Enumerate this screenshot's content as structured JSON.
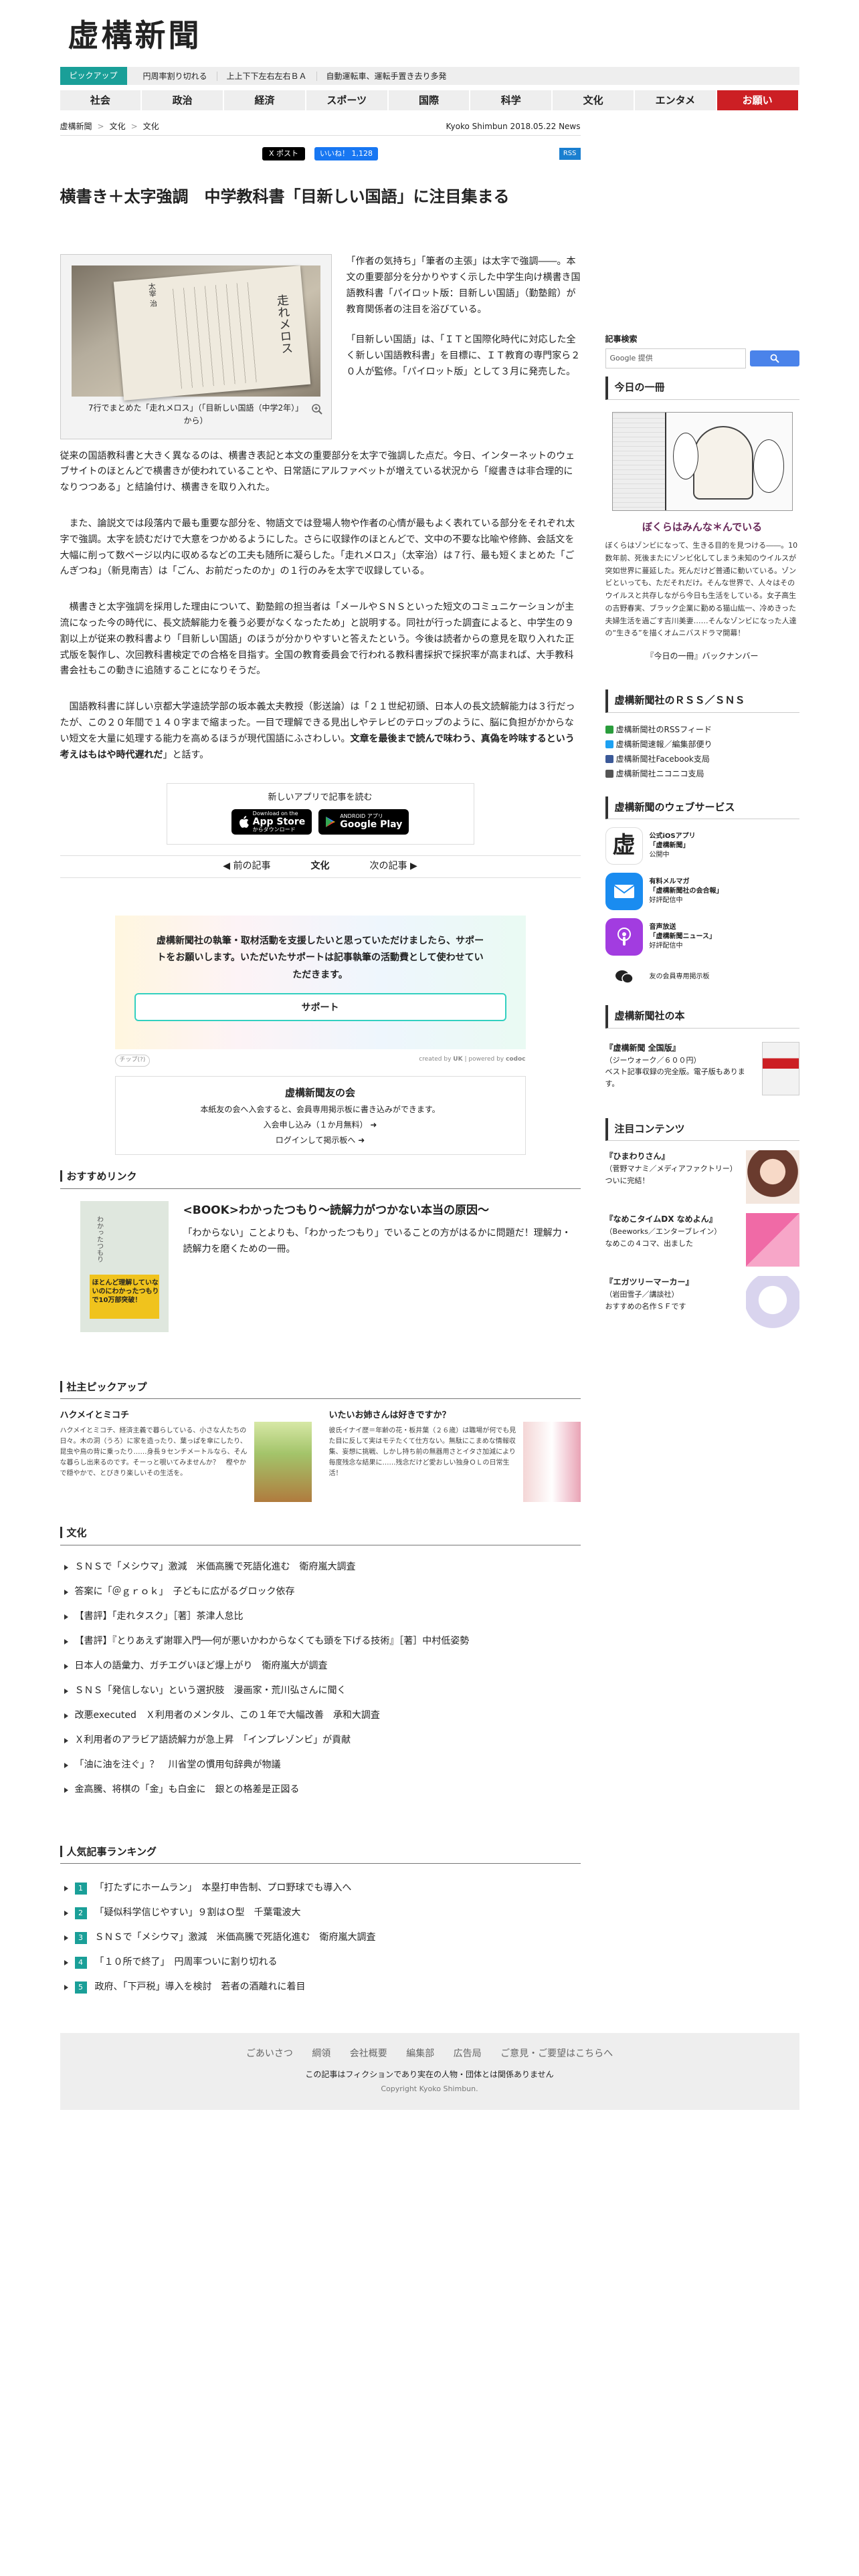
{
  "site": {
    "logo": "虚構新聞"
  },
  "pickup": {
    "tag": "ピックアップ",
    "items": [
      "円周率割り切れる",
      "上上下下左右左右ＢＡ",
      "自動運転車、運転手置き去り多発"
    ]
  },
  "nav": [
    "社会",
    "政治",
    "経済",
    "スポーツ",
    "国際",
    "科学",
    "文化",
    "エンタメ",
    "お願い"
  ],
  "breadcrumb": {
    "items": [
      "虚構新聞",
      "文化",
      "文化"
    ],
    "meta": "Kyoko Shimbun 2018.05.22 News"
  },
  "share": {
    "x": "X ポスト",
    "fb": "いいね！ 1,128",
    "rss": "RSS"
  },
  "article": {
    "title": "横書き＋太字強調　中学教科書「目新しい国語」に注目集まる",
    "caption": "7行でまとめた「走れメロス」（「目新しい国語（中学2年）」から）",
    "photo_title": "走れメロス",
    "photo_author": "太宰 治",
    "lead": [
      "「作者の気持ち」「筆者の主張」は太字で強調――。本文の重要部分を分かりやすく示した中学生向け横書き国語教科書「パイロット版：目新しい国語」（勤塾館）が教育関係者の注目を浴びている。",
      "「目新しい国語」は、「ＩＴと国際化時代に対応した全く新しい国語教科書」を目標に、ＩＴ教育の専門家ら２０人が監修。「パイロット版」として３月に発売した。",
      "従来の国語教科書と大きく異なるのは、横書き表記と本文の重要部分を太字で強調した点だ。今日、インターネットのウェブサイトのほとんどで横書きが使われていることや、日常語にアルファベットが増えている状況から「縦書きは非合理的になりつつある」と結論付け、横書きを取り入れた。"
    ],
    "body": [
      "また、論説文では段落内で最も重要な部分を、物語文では登場人物や作者の心情が最もよく表れている部分をそれぞれ太字で強調。太字を読むだけで大意をつかめるようにした。さらに収録作のほとんどで、文中の不要な比喩や修飾、会話文を大幅に削って数ページ以内に収めるなどの工夫も随所に凝らした。「走れメロス」（太宰治）は７行、最も短くまとめた「ごんぎつね」（新見南吉）は「ごん、お前だったのか」の１行のみを太字で収録している。",
      "横書きと太字強調を採用した理由について、勤塾館の担当者は「メールやＳＮＳといった短文のコミュニケーションが主流になった今の時代に、長文読解能力を養う必要がなくなったため」と説明する。同社が行った調査によると、中学生の９割以上が従来の教科書より「目新しい国語」のほうが分かりやすいと答えたという。今後は読者からの意見を取り入れた正式版を製作し、次回教科書検定での合格を目指す。全国の教育委員会で行われる教科書採択で採択率が高まれば、大手教科書会社もこの動きに追随することになりそうだ。",
      "国語教科書に詳しい京都大学遠読学部の坂本義太夫教授（影送論）は「２１世紀初頭、日本人の長文読解能力は３行だったが、この２０年間で１４０字まで縮まった。一目で理解できる見出しやテレビのテロップのように、脳に負担がかからない短文を大量に処理する能力を高めるほうが現代国語にふさわしい。",
      "文章を最後まで読んで味わう、真偽を吟味するという考えはもはや時代遅れだ",
      "」と話す。"
    ]
  },
  "app": {
    "label": "新しいアプリで記事を読む",
    "appstore_small": "Download on the",
    "appstore": "App Store",
    "appstore_jp": "からダウンロード",
    "gplay_small": "ANDROID アプリ",
    "gplay": "Google Play"
  },
  "pager": {
    "prev": "前の記事",
    "current": "文化",
    "next": "次の記事"
  },
  "support": {
    "message": "虚構新聞社の執筆・取材活動を支援したいと思っていただけましたら、サポートをお願いします。いただいたサポートは記事執筆の活動費として使わせていただきます。",
    "button": "サポート",
    "tip": "チップ(?)",
    "created_by": "created by",
    "created_by_name": "UK",
    "powered": "powered by",
    "powered_name": "codoc"
  },
  "members": {
    "title": "虚構新聞友の会",
    "desc": "本紙友の会へ入会すると、会員専用掲示板に書き込みができます。",
    "join": "入会申し込み（１か月無料）",
    "login": "ログインして掲示板へ"
  },
  "recommend": {
    "heading": "おすすめリンク",
    "title": "<BOOK>わかったつもり〜読解力がつかない本当の原因〜",
    "desc": "「わからない」ことよりも、「わかったつもり」でいることの方がはるかに問題だ！理解力・読解力を磨くための一冊。",
    "book_title": "わかったつもり",
    "book_band": "ほとんど理解していないのにわかったつもりで10万部突破！"
  },
  "pickup2": {
    "heading": "社主ピックアップ",
    "items": [
      {
        "title": "ハクメイとミコチ",
        "desc": "ハクメイとミコチ、経済主義で暮らしている、小さな人たちの日々。木の洞（うろ）に家を造ったり、葉っぱを傘にしたり、昆虫や鳥の背に乗ったり……身長９センチメートルなら、そんな暮らし出来るのです。そーっと覗いてみませんか？　樫やかで穏やかで、とびきり楽しいその生活を。"
      },
      {
        "title": "いたいお姉さんは好きですか？",
        "desc": "彼氏イナイ歴＝年齢の花・板井葉（２６歳）は職場が何でも見た目に反して実はモテたくて仕方ない。無駄にこまめな情報収集、妄想に挑戦、しかし持ち前の無器用さとイタさ加減により毎度残念な結果に……残念だけど愛おしい独身ＯＬの日常生活！"
      }
    ]
  },
  "culture": {
    "heading": "文化",
    "items": [
      "ＳＮＳで「メシウマ」激減　米価高騰で死語化進む　衛府嵐大調査",
      "答案に「＠ｇｒｏｋ」　子どもに広がるグロック依存",
      "【書評】「走れタスク」［著］茶津人怠比",
      "【書評】『とりあえず謝罪入門──何が悪いかわからなくても頭を下げる技術』［著］中村低姿勢",
      "日本人の語彙力、ガチエグいほど爆上がり　衛府嵐大が調査",
      "ＳＮＳ「発信しない」という選択肢　漫画家・荒川弘さんに聞く",
      "改悪executed　Ｘ利用者のメンタル、この１年で大幅改善　承和大調査",
      "Ｘ利用者のアラビア語読解力が急上昇　「インプレゾンビ」が貢献",
      "「油に油を注ぐ」？　川省堂の慣用句辞典が物議",
      "金高騰、将棋の「金」も白金に　銀との格差是正図る"
    ]
  },
  "ranking": {
    "heading": "人気記事ランキング",
    "items": [
      "「打たずにホームラン」　本塁打申告制、プロ野球でも導入へ",
      "「疑似科学信じやすい」９割はＯ型　千葉電波大",
      "ＳＮＳで「メシウマ」激減　米価高騰で死語化進む　衛府嵐大調査",
      "「１０所で終了」　円周率ついに割り切れる",
      "政府、「下戸税」導入を検討　若者の酒離れに着目"
    ]
  },
  "sidebar": {
    "search_label": "記事検索",
    "search_placeholder": "Google 提供",
    "book_heading": "今日の一冊",
    "book_title": "ぼくらはみんな＊んでいる",
    "book_desc": "ぼくらはゾンビになって、生きる目的を見つける――。10数年前、死後またにゾンビ化してしまう未知のウイルスが突如世界に蔓延した。死んだけど普通に動いている。ゾンビといっても、ただそれだけ。そんな世界で、人々はそのウイルスと共存しながら今日も生活をしている。女子高生の吉野春実、ブラック企業に勤める猫山紘一、冷めきった夫婦生活を過ごす吉川美妻……そんなゾンビになった人達の“生きる”を描くオムニバスドラマ開幕！",
    "backnumber": "『今日の一冊』バックナンバー",
    "rss_heading": "虚構新聞社のＲＳＳ／ＳＮＳ",
    "rss_links": [
      "虚構新聞社のRSSフィード",
      "虚構新聞速報／編集部便り",
      "虚構新聞社Facebook支局",
      "虚構新聞社ニコニコ支局"
    ],
    "services_heading": "虚構新聞のウェブサービス",
    "services": [
      {
        "type": "公式iOSアプリ",
        "name": "「虚構新聞」",
        "status": "公開中"
      },
      {
        "type": "有料メルマガ",
        "name": "「虚構新聞社の会合報」",
        "status": "好評配信中"
      },
      {
        "type": "音声放送",
        "name": "「虚構新聞ニュース」",
        "status": "好評配信中"
      },
      {
        "type": "友の会",
        "name": "友の会員専用掲示板",
        "status": ""
      }
    ],
    "books_heading": "虚構新聞社の本",
    "book_ad": {
      "title": "『虚構新聞 全国版』",
      "pub": "（ジーウォーク／６００円）",
      "desc": "ベスト記事収録の完全版。電子版もあります。"
    },
    "attention_heading": "注目コンテンツ",
    "attention": [
      {
        "title": "『ひまわりさん』",
        "sub": "（菅野マナミ／メディアファクトリー）",
        "desc": "ついに完結！"
      },
      {
        "title": "『なめこタイムDX なめよん』",
        "sub": "（Beeworks／エンターブレイン）",
        "desc": "なめこの４コマ、出ました"
      },
      {
        "title": "『エガツリーマーカー』",
        "sub": "（岩田雪子／講談社）",
        "desc": "おすすめの名作ＳＦです"
      }
    ],
    "colors": {
      "teal": "#1a9f98",
      "red": "#cc1f24",
      "blue": "#4a83ea"
    }
  },
  "footer": {
    "links": [
      "ごあいさつ",
      "綱領",
      "会社概要",
      "編集部",
      "広告局",
      "ご意見・ご要望はこちらへ"
    ],
    "note": "この記事はフィクションであり実在の人物・団体とは関係ありません",
    "copyright": "Copyright Kyoko Shimbun."
  }
}
